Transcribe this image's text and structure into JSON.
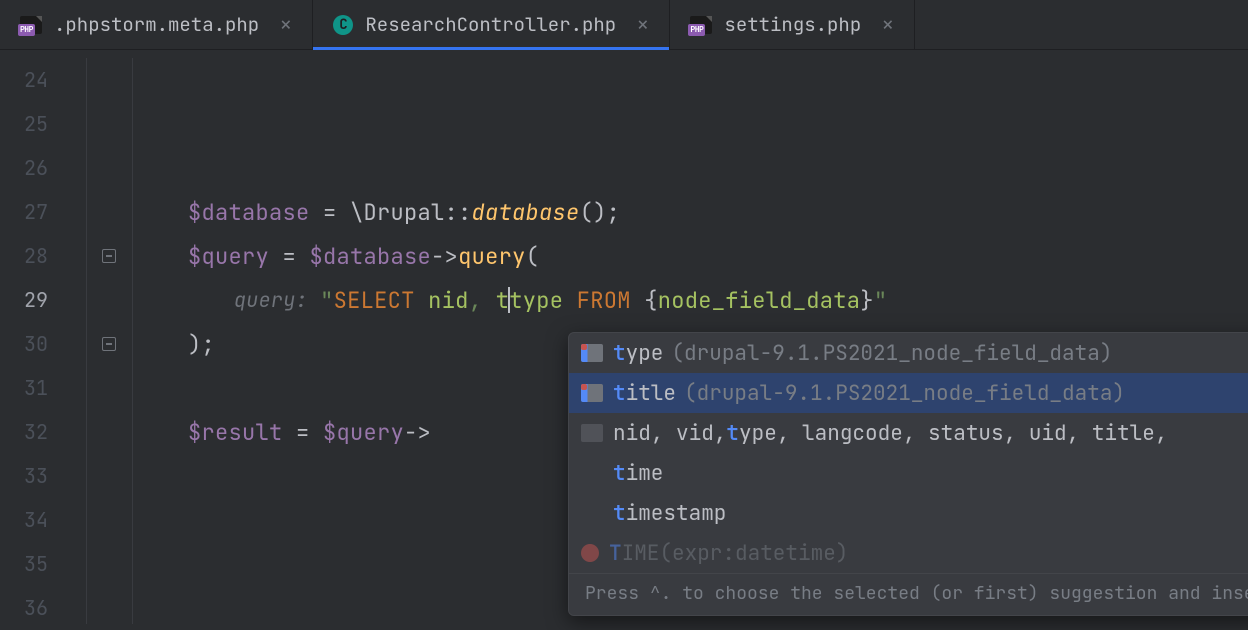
{
  "tabs": [
    {
      "label": ".phpstorm.meta.php",
      "icon": "php",
      "active": false
    },
    {
      "label": "ResearchController.php",
      "icon": "class",
      "iconLetter": "C",
      "active": true
    },
    {
      "label": "settings.php",
      "icon": "php",
      "active": false
    }
  ],
  "gutter": {
    "start": 24,
    "end": 36,
    "activeLine": 29,
    "foldMarkers": [
      28,
      30
    ]
  },
  "code": {
    "line27": {
      "var": "$database",
      "eq": " = ",
      "ns": "\\Drupal::",
      "method": "database",
      "tail": "();"
    },
    "line28": {
      "var": "$query",
      "eq": " = ",
      "var2": "$database",
      "arrow": "->",
      "method": "query",
      "open": "("
    },
    "line29": {
      "hint": "query: ",
      "q1": "\"",
      "kw1": "SELECT",
      "sp1": " ",
      "id1": "nid",
      "comma": ", ",
      "typedPrefix": "t",
      "afterCursor": "type",
      "sp2": " ",
      "kw2": "FROM",
      "sp3": " ",
      "brace1": "{",
      "table": "node_field_data",
      "brace2": "}",
      "q2": "\""
    },
    "line30": {
      "close": ");"
    },
    "line32": {
      "var": "$result",
      "eq": " = ",
      "var2": "$query",
      "arrow": "->"
    }
  },
  "popup": {
    "items": [
      {
        "icon": "column",
        "hl": "t",
        "text": "ype",
        "meta": "(drupal-9.1.PS2021_node_field_data)",
        "selected": false
      },
      {
        "icon": "column",
        "hl": "t",
        "text": "itle",
        "meta": "(drupal-9.1.PS2021_node_field_data)",
        "selected": true
      },
      {
        "icon": "column-dim",
        "multi": true,
        "parts": [
          "nid, vid, ",
          "t",
          "ype, langcode, status, uid, title,"
        ]
      },
      {
        "icon": "none",
        "hl": "t",
        "text": "ime"
      },
      {
        "icon": "none",
        "hl": "t",
        "text": "imestamp"
      },
      {
        "icon": "func",
        "dim": true,
        "hl": "T",
        "text": "IME(expr:datetime)"
      }
    ],
    "footer": "Press ^. to choose the selected (or first) suggestion and insert a "
  }
}
